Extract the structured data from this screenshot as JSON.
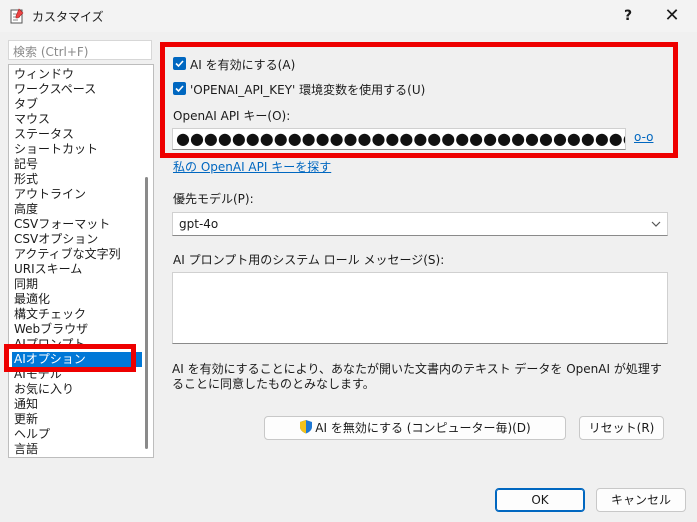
{
  "window": {
    "title": "カスタマイズ",
    "help_label": "?",
    "close_label": "✕"
  },
  "sidebar": {
    "search_placeholder": "検索 (Ctrl+F)",
    "items": [
      "ウィンドウ",
      "ワークスペース",
      "タブ",
      "マウス",
      "ステータス",
      "ショートカット",
      "記号",
      "形式",
      "アウトライン",
      "高度",
      "CSVフォーマット",
      "CSVオプション",
      "アクティブな文字列",
      "URIスキーム",
      "同期",
      "最適化",
      "構文チェック",
      "Webブラウザ",
      "AIプロンプト",
      "AIオプション",
      "AIモデル",
      "お気に入り",
      "通知",
      "更新",
      "ヘルプ",
      "言語"
    ],
    "selected_index": 19
  },
  "ai": {
    "enable_label": "AI を有効にする(A)",
    "env_label": "'OPENAI_API_KEY' 環境変数を使用する(U)",
    "api_key_label": "OpenAI API キー(O):",
    "api_key_value": "●●●●●●●●●●●●●●●●●●●●●●●●●●●●●●●●●●●●●●●●●●●●●●",
    "show_key_label": "o-o",
    "find_key_link": "私の OpenAI API キーを探す",
    "model_label": "優先モデル(P):",
    "model_value": "gpt-4o",
    "system_msg_label": "AI プロンプト用のシステム ロール メッセージ(S):",
    "system_msg_value": "",
    "notice": "AI を有効にすることにより、あなたが開いた文書内のテキスト データを OpenAI が処理することに同意したものとみなします。",
    "disable_button": "AI を無効にする (コンピューター毎)(D)",
    "reset_button": "リセット(R)"
  },
  "footer": {
    "ok_label": "OK",
    "cancel_label": "キャンセル"
  },
  "colors": {
    "accent": "#0067c0",
    "highlight": "#ee0000",
    "selection": "#0078d7"
  }
}
